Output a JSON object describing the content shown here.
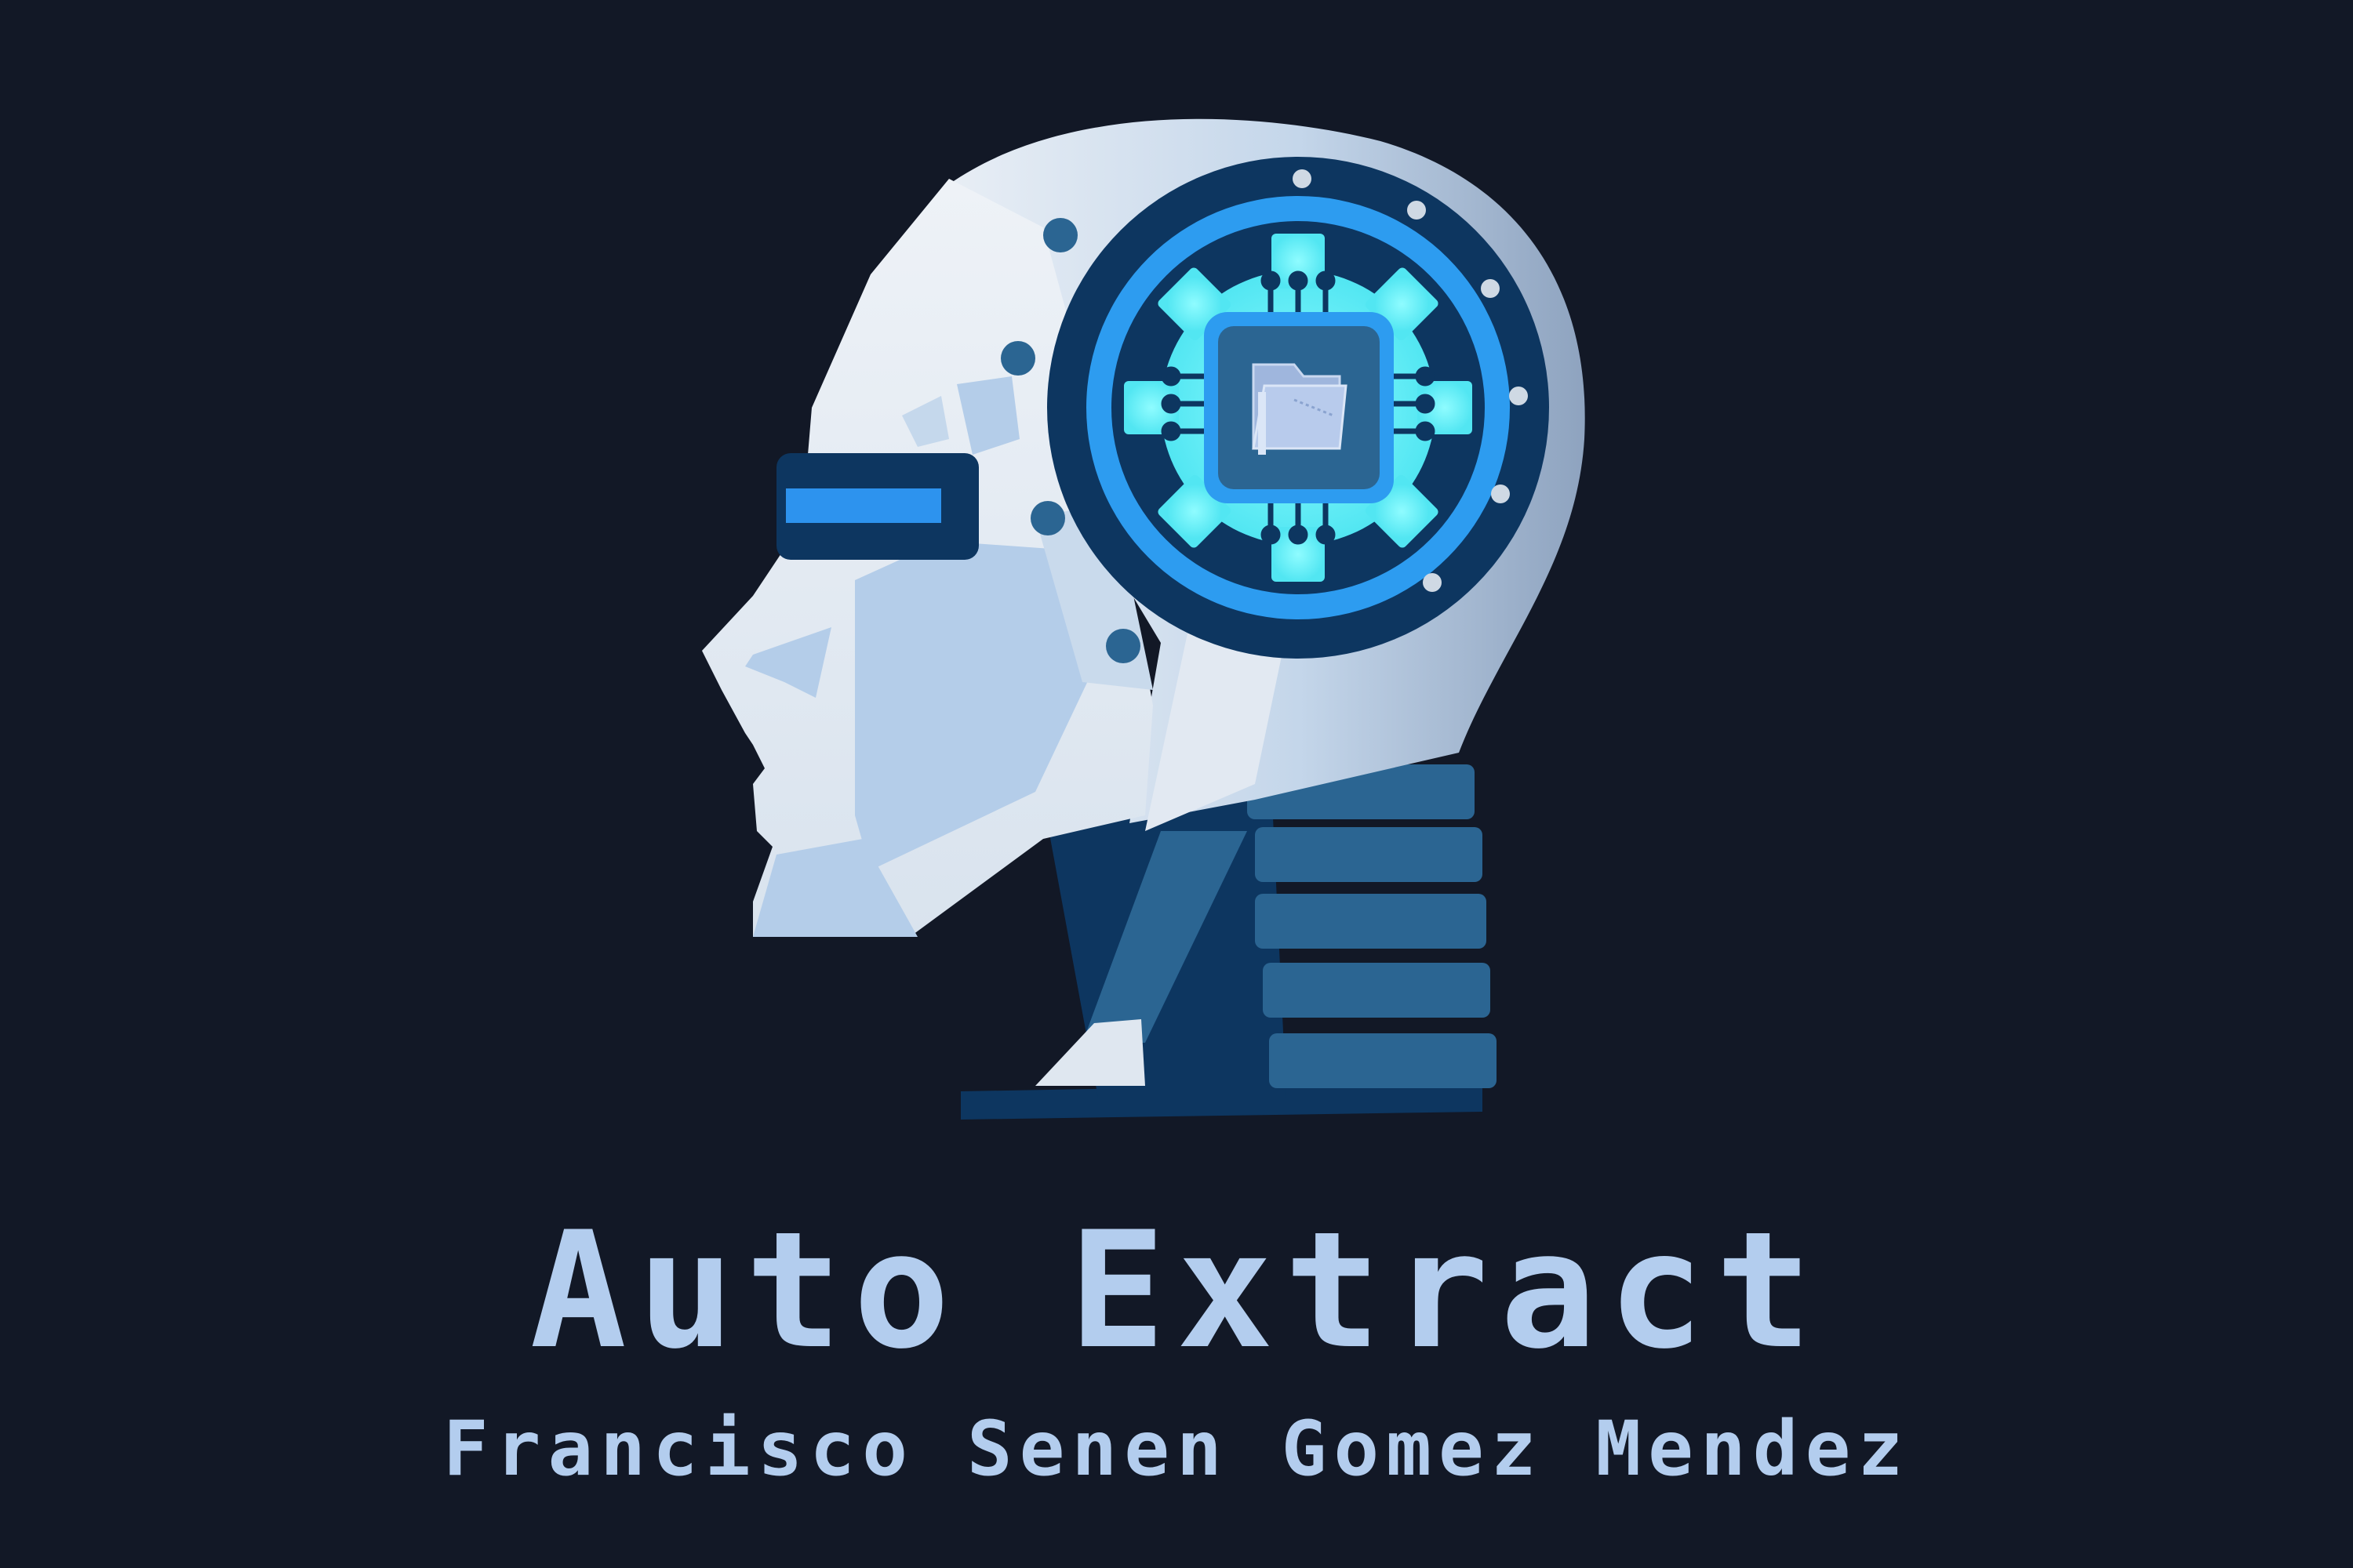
{
  "title": "Auto Extract",
  "author": "Francisco Senen Gomez Mendez",
  "colors": {
    "background": "#121826",
    "text": "#b3cdee",
    "face_light": "#e4ebf3",
    "face_blue": "#b4cde9",
    "dark_navy": "#0d3660",
    "mid_blue": "#2b6592",
    "ring_blue": "#2d9cf0",
    "gear_cyan": "#5ff2f7",
    "visor": "#2d93ee"
  },
  "icons": {
    "logo": "robot-head-icon",
    "chip": "chip-icon",
    "folder": "folder-icon"
  }
}
